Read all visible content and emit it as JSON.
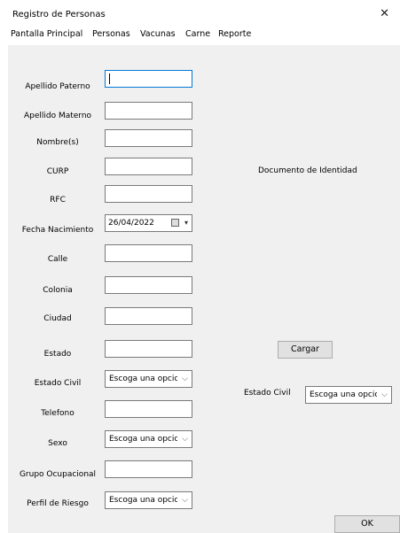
{
  "window": {
    "title": "Registro de Personas"
  },
  "menu": [
    "Pantalla Principal",
    "Personas",
    "Vacunas",
    "Carne",
    "Reporte"
  ],
  "form": {
    "apellido_paterno": "Apellido Paterno",
    "apellido_materno": "Apellido Materno",
    "nombres": "Nombre(s)",
    "curp": "CURP",
    "rfc": "RFC",
    "fecha_nacimiento": "Fecha Nacimiento",
    "fecha_value": "26/04/2022",
    "calle": "Calle",
    "colonia": "Colonia",
    "ciudad": "Ciudad",
    "estado": "Estado",
    "estado_civil": "Estado Civil",
    "telefono": "Telefono",
    "sexo": "Sexo",
    "grupo_ocupacional": "Grupo Ocupacional",
    "perfil_riesgo": "Perfil de Riesgo",
    "select_placeholder": "Escoga una opcior"
  },
  "right": {
    "documento_label": "Documento de Identidad",
    "cargar_button": "Cargar",
    "estado_civil_label": "Estado Civil",
    "select_value": "Escoga una opcior"
  },
  "footer": {
    "ok_button": "OK"
  }
}
